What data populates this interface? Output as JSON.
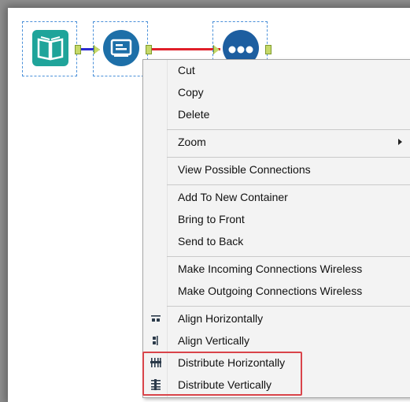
{
  "workflow": {
    "tools": [
      {
        "name": "input-data-tool",
        "icon": "book-icon",
        "color": "#1fa49a"
      },
      {
        "name": "browse-tool",
        "icon": "browse-icon",
        "color": "#1d6fa8"
      },
      {
        "name": "join-tool",
        "icon": "dots-icon",
        "color": "#1d5ea0"
      }
    ],
    "connections": [
      {
        "from": "input-data-tool",
        "to": "browse-tool",
        "color": "#2b2bd0"
      },
      {
        "from": "browse-tool",
        "to": "join-tool",
        "color": "#e0202a"
      }
    ]
  },
  "context_menu": {
    "groups": [
      [
        {
          "label": "Cut"
        },
        {
          "label": "Copy"
        },
        {
          "label": "Delete"
        }
      ],
      [
        {
          "label": "Zoom",
          "submenu": true
        }
      ],
      [
        {
          "label": "View Possible Connections"
        }
      ],
      [
        {
          "label": "Add To New Container"
        },
        {
          "label": "Bring to Front"
        },
        {
          "label": "Send to Back"
        }
      ],
      [
        {
          "label": "Make Incoming Connections Wireless"
        },
        {
          "label": "Make Outgoing Connections Wireless"
        }
      ],
      [
        {
          "label": "Align Horizontally",
          "icon": "align-horizontal-icon"
        },
        {
          "label": "Align Vertically",
          "icon": "align-vertical-icon"
        },
        {
          "label": "Distribute Horizontally",
          "icon": "distribute-horizontal-icon",
          "highlighted": true
        },
        {
          "label": "Distribute Vertically",
          "icon": "distribute-vertical-icon",
          "highlighted": true
        }
      ]
    ]
  },
  "colors": {
    "highlight_border": "#d9444a",
    "menu_background": "#f3f3f3",
    "selection_border": "#4a90d9"
  }
}
